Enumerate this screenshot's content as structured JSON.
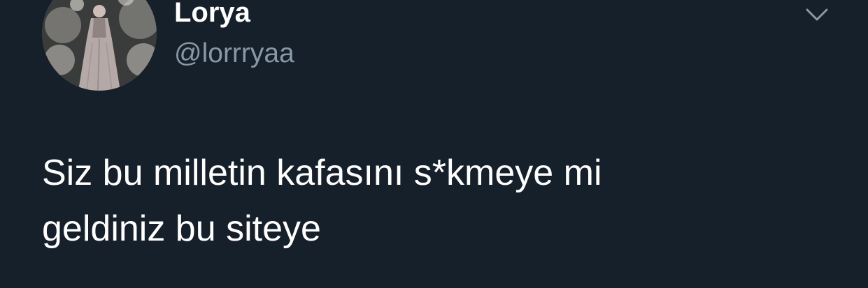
{
  "tweet": {
    "author": {
      "display_name": "Lorya",
      "handle": "@lorrryaa",
      "avatar_icon": "profile-photo-avatar"
    },
    "menu_icon": "chevron-down-icon",
    "text_lines": [
      "Siz bu milletin kafasını s*kmeye mi",
      "geldiniz bu siteye"
    ]
  },
  "theme": {
    "background": "#15202b",
    "primary_text": "#ffffff",
    "secondary_text": "#8899a6"
  }
}
